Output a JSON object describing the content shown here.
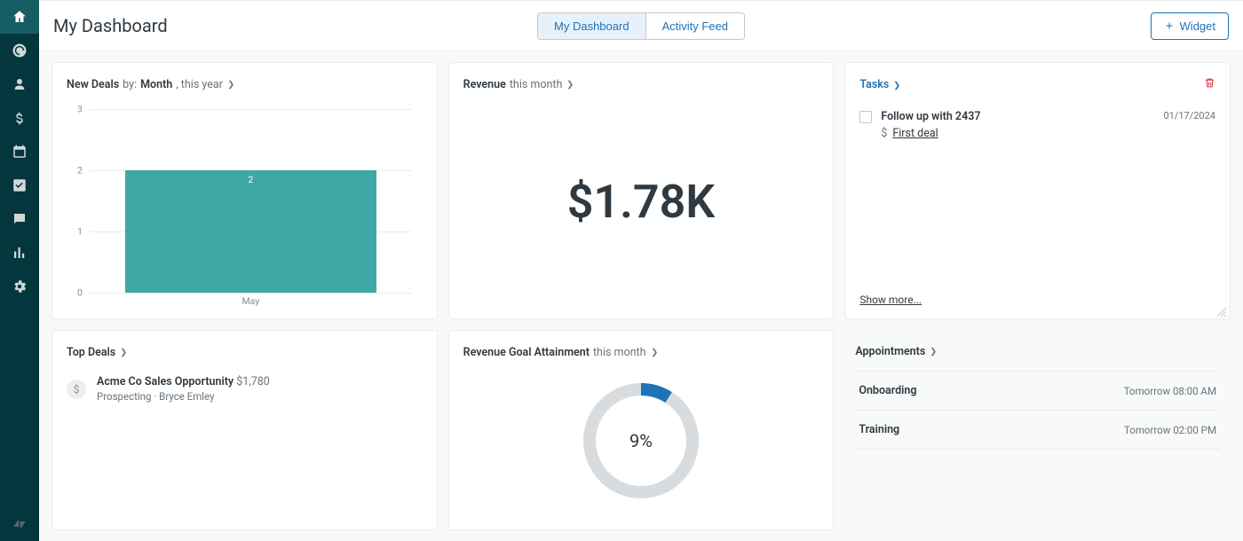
{
  "page_title": "My Dashboard",
  "tabs": {
    "my_dashboard": "My Dashboard",
    "activity_feed": "Activity Feed"
  },
  "widget_button": "Widget",
  "new_deals": {
    "label": "New Deals",
    "by": "by:",
    "period_bold": "Month",
    "period_suffix": ", this year"
  },
  "revenue": {
    "label": "Revenue",
    "suffix": "this month",
    "value": "$1.78K"
  },
  "tasks": {
    "label": "Tasks",
    "items": [
      {
        "title": "Follow up with 2437",
        "deal": "First deal",
        "date": "01/17/2024"
      }
    ],
    "show_more": "Show more..."
  },
  "top_deals": {
    "label": "Top Deals",
    "items": [
      {
        "name": "Acme Co Sales Opportunity",
        "amount": "$1,780",
        "stage": "Prospecting",
        "owner": "Bryce Emley"
      }
    ]
  },
  "goal": {
    "label": "Revenue Goal Attainment",
    "suffix": "this month",
    "percent_label": "9%",
    "percent": 9
  },
  "appointments": {
    "label": "Appointments",
    "items": [
      {
        "name": "Onboarding",
        "time": "Tomorrow 08:00 AM"
      },
      {
        "name": "Training",
        "time": "Tomorrow 02:00 PM"
      }
    ]
  },
  "chart_data": {
    "type": "bar",
    "title": "New Deals by Month, this year",
    "categories": [
      "May"
    ],
    "values": [
      2
    ],
    "xlabel": "",
    "ylabel": "",
    "ylim": [
      0,
      3
    ],
    "yticks": [
      0,
      1,
      2,
      3
    ]
  },
  "colors": {
    "brand": "#1f73b7",
    "bar": "#3ea8a6",
    "danger": "#d93f4c"
  }
}
